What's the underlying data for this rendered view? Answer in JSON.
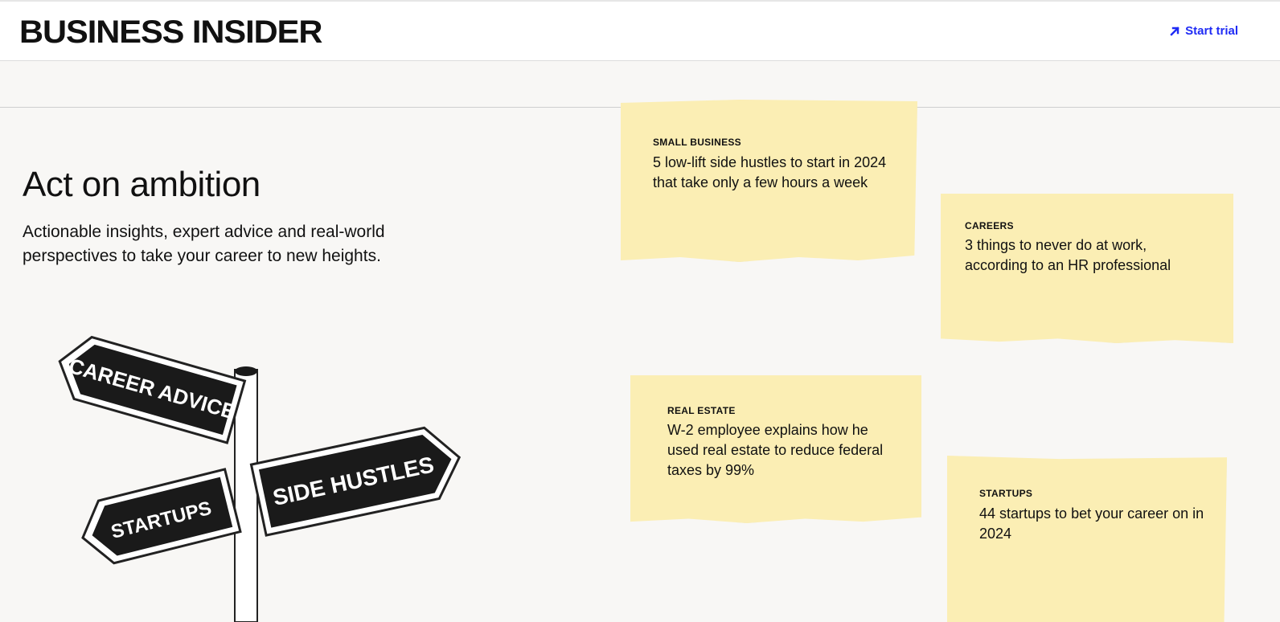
{
  "header": {
    "logo": "BUSINESS INSIDER",
    "start_trial_label": "Start trial"
  },
  "hero": {
    "title": "Act on ambition",
    "subtitle": "Actionable insights, expert advice and real-world perspectives to take your career to new heights."
  },
  "signpost": {
    "signs": [
      "CAREER ADVICE",
      "SIDE HUSTLES",
      "STARTUPS"
    ]
  },
  "notes": [
    {
      "kicker": "SMALL BUSINESS",
      "headline": "5 low-lift side hustles to start in 2024 that take only a few hours a week"
    },
    {
      "kicker": "CAREERS",
      "headline": "3 things to never do at work, according to an HR professional"
    },
    {
      "kicker": "REAL ESTATE",
      "headline": "W-2 employee explains how he used real estate to reduce federal taxes by 99%"
    },
    {
      "kicker": "STARTUPS",
      "headline": "44 startups to bet your career on in 2024"
    }
  ],
  "colors": {
    "accent": "#1f2bf5",
    "note_bg": "#fbeeb4",
    "page_bg": "#f8f7f5"
  },
  "icons": {
    "start_trial": "arrow-up-right-icon",
    "signpost": "signpost-image"
  }
}
